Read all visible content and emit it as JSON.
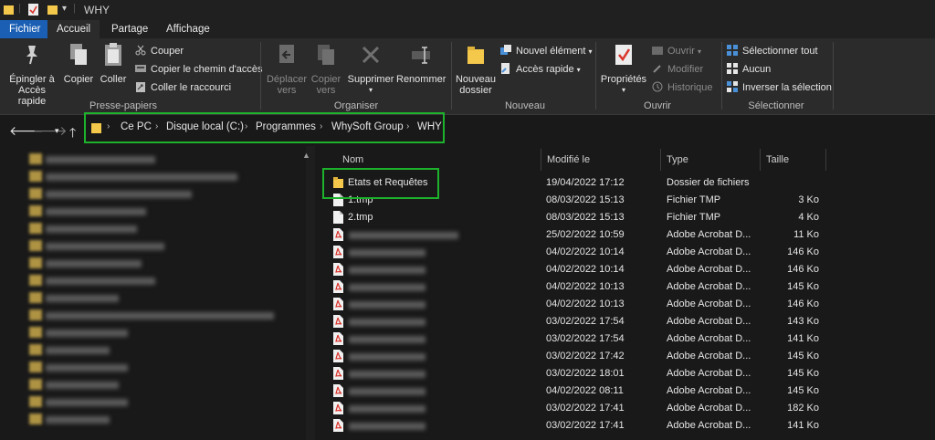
{
  "titlebar": {
    "title": "WHY"
  },
  "tabs": [
    "Fichier",
    "Accueil",
    "Partage",
    "Affichage"
  ],
  "ribbon": {
    "groups": {
      "clipboard": "Presse-papiers",
      "organize": "Organiser",
      "new": "Nouveau",
      "open": "Ouvrir",
      "select": "Sélectionner"
    },
    "pin_line1": "Épingler à",
    "pin_line2": "Accès rapide",
    "copy": "Copier",
    "paste": "Coller",
    "cut": "Couper",
    "copy_path": "Copier le chemin d'accès",
    "paste_shortcut": "Coller le raccourci",
    "move_line1": "Déplacer",
    "move_line2": "vers",
    "copyto_line1": "Copier",
    "copyto_line2": "vers",
    "delete": "Supprimer",
    "rename": "Renommer",
    "newfolder_line1": "Nouveau",
    "newfolder_line2": "dossier",
    "new_item": "Nouvel élément",
    "easy_access": "Accès rapide",
    "properties": "Propriétés",
    "open": "Ouvrir",
    "edit": "Modifier",
    "history": "Historique",
    "select_all": "Sélectionner tout",
    "select_none": "Aucun",
    "invert": "Inverser la sélection"
  },
  "address": {
    "crumbs": [
      "Ce PC",
      "Disque local (C:)",
      "Programmes",
      "WhySoft Group",
      "WHY"
    ]
  },
  "columns": {
    "name": "Nom",
    "modified": "Modifié le",
    "type": "Type",
    "size": "Taille"
  },
  "files": [
    {
      "name": "Etats et Requêtes",
      "date": "19/04/2022 17:12",
      "type": "Dossier de fichiers",
      "size": "",
      "icon": "folder"
    },
    {
      "name": "1.tmp",
      "date": "08/03/2022 15:13",
      "type": "Fichier TMP",
      "size": "3 Ko",
      "icon": "file"
    },
    {
      "name": "2.tmp",
      "date": "08/03/2022 15:13",
      "type": "Fichier TMP",
      "size": "4 Ko",
      "icon": "file"
    },
    {
      "name": "",
      "date": "25/02/2022 10:59",
      "type": "Adobe Acrobat D...",
      "size": "11 Ko",
      "icon": "pdf"
    },
    {
      "name": "",
      "date": "04/02/2022 10:14",
      "type": "Adobe Acrobat D...",
      "size": "146 Ko",
      "icon": "pdf"
    },
    {
      "name": "",
      "date": "04/02/2022 10:14",
      "type": "Adobe Acrobat D...",
      "size": "146 Ko",
      "icon": "pdf"
    },
    {
      "name": "",
      "date": "04/02/2022 10:13",
      "type": "Adobe Acrobat D...",
      "size": "145 Ko",
      "icon": "pdf"
    },
    {
      "name": "",
      "date": "04/02/2022 10:13",
      "type": "Adobe Acrobat D...",
      "size": "146 Ko",
      "icon": "pdf"
    },
    {
      "name": "",
      "date": "03/02/2022 17:54",
      "type": "Adobe Acrobat D...",
      "size": "143 Ko",
      "icon": "pdf"
    },
    {
      "name": "",
      "date": "03/02/2022 17:54",
      "type": "Adobe Acrobat D...",
      "size": "141 Ko",
      "icon": "pdf"
    },
    {
      "name": "",
      "date": "03/02/2022 17:42",
      "type": "Adobe Acrobat D...",
      "size": "145 Ko",
      "icon": "pdf"
    },
    {
      "name": "",
      "date": "03/02/2022 18:01",
      "type": "Adobe Acrobat D...",
      "size": "145 Ko",
      "icon": "pdf"
    },
    {
      "name": "",
      "date": "04/02/2022 08:11",
      "type": "Adobe Acrobat D...",
      "size": "145 Ko",
      "icon": "pdf"
    },
    {
      "name": "",
      "date": "03/02/2022 17:41",
      "type": "Adobe Acrobat D...",
      "size": "182 Ko",
      "icon": "pdf"
    },
    {
      "name": "",
      "date": "03/02/2022 17:41",
      "type": "Adobe Acrobat D...",
      "size": "141 Ko",
      "icon": "pdf"
    }
  ],
  "colors": {
    "accent": "#1a5fb4",
    "highlight": "#1db22b",
    "folder": "#f4c84a",
    "pdf": "#d9342b"
  }
}
